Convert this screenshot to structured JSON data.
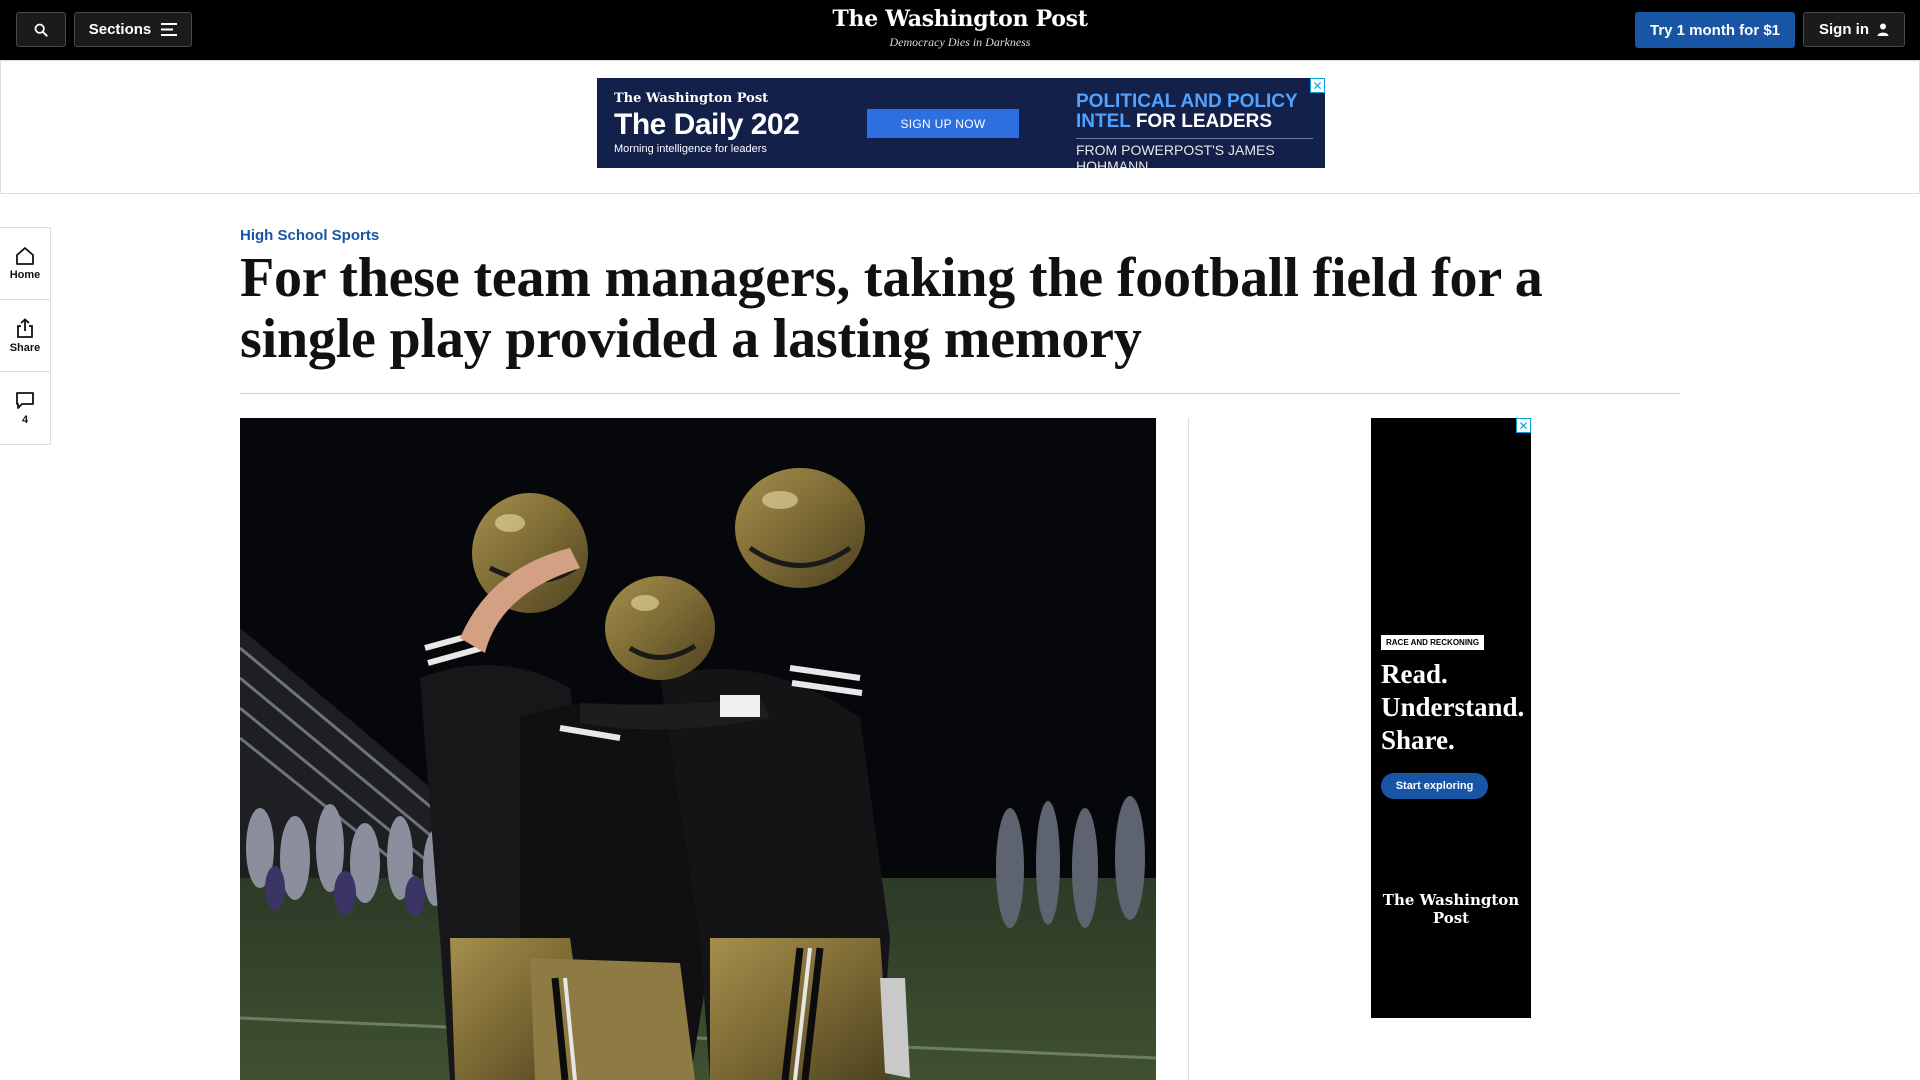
{
  "nav": {
    "search_icon": "search-icon",
    "sections_label": "Sections",
    "masthead_logo": "The Washington Post",
    "masthead_tagline": "Democracy Dies in Darkness",
    "trial_label": "Try 1 month for $1",
    "signin_label": "Sign in"
  },
  "top_ad": {
    "logo": "The Washington Post",
    "title": "The Daily 202",
    "subtitle": "Morning intelligence for leaders",
    "cta": "SIGN UP NOW",
    "headline_blue": "POLITICAL AND POLICY INTEL",
    "headline_white": "FOR LEADERS",
    "byline": "FROM POWERPOST'S JAMES HOHMANN",
    "close": "✕"
  },
  "left_rail": {
    "home_label": "Home",
    "share_label": "Share",
    "comments_count": "4"
  },
  "article": {
    "kicker": "High School Sports",
    "headline": "For these team managers, taking the football field for a single play provided a lasting memory"
  },
  "side_ad": {
    "tag": "RACE AND RECKONING",
    "headline": "Read. Understand. Share.",
    "cta": "Start exploring",
    "logo": "The Washington Post",
    "close": "✕"
  },
  "colors": {
    "brand_blue": "#1955a5",
    "nav_bg": "#000000",
    "ad_navy": "#13204a"
  }
}
